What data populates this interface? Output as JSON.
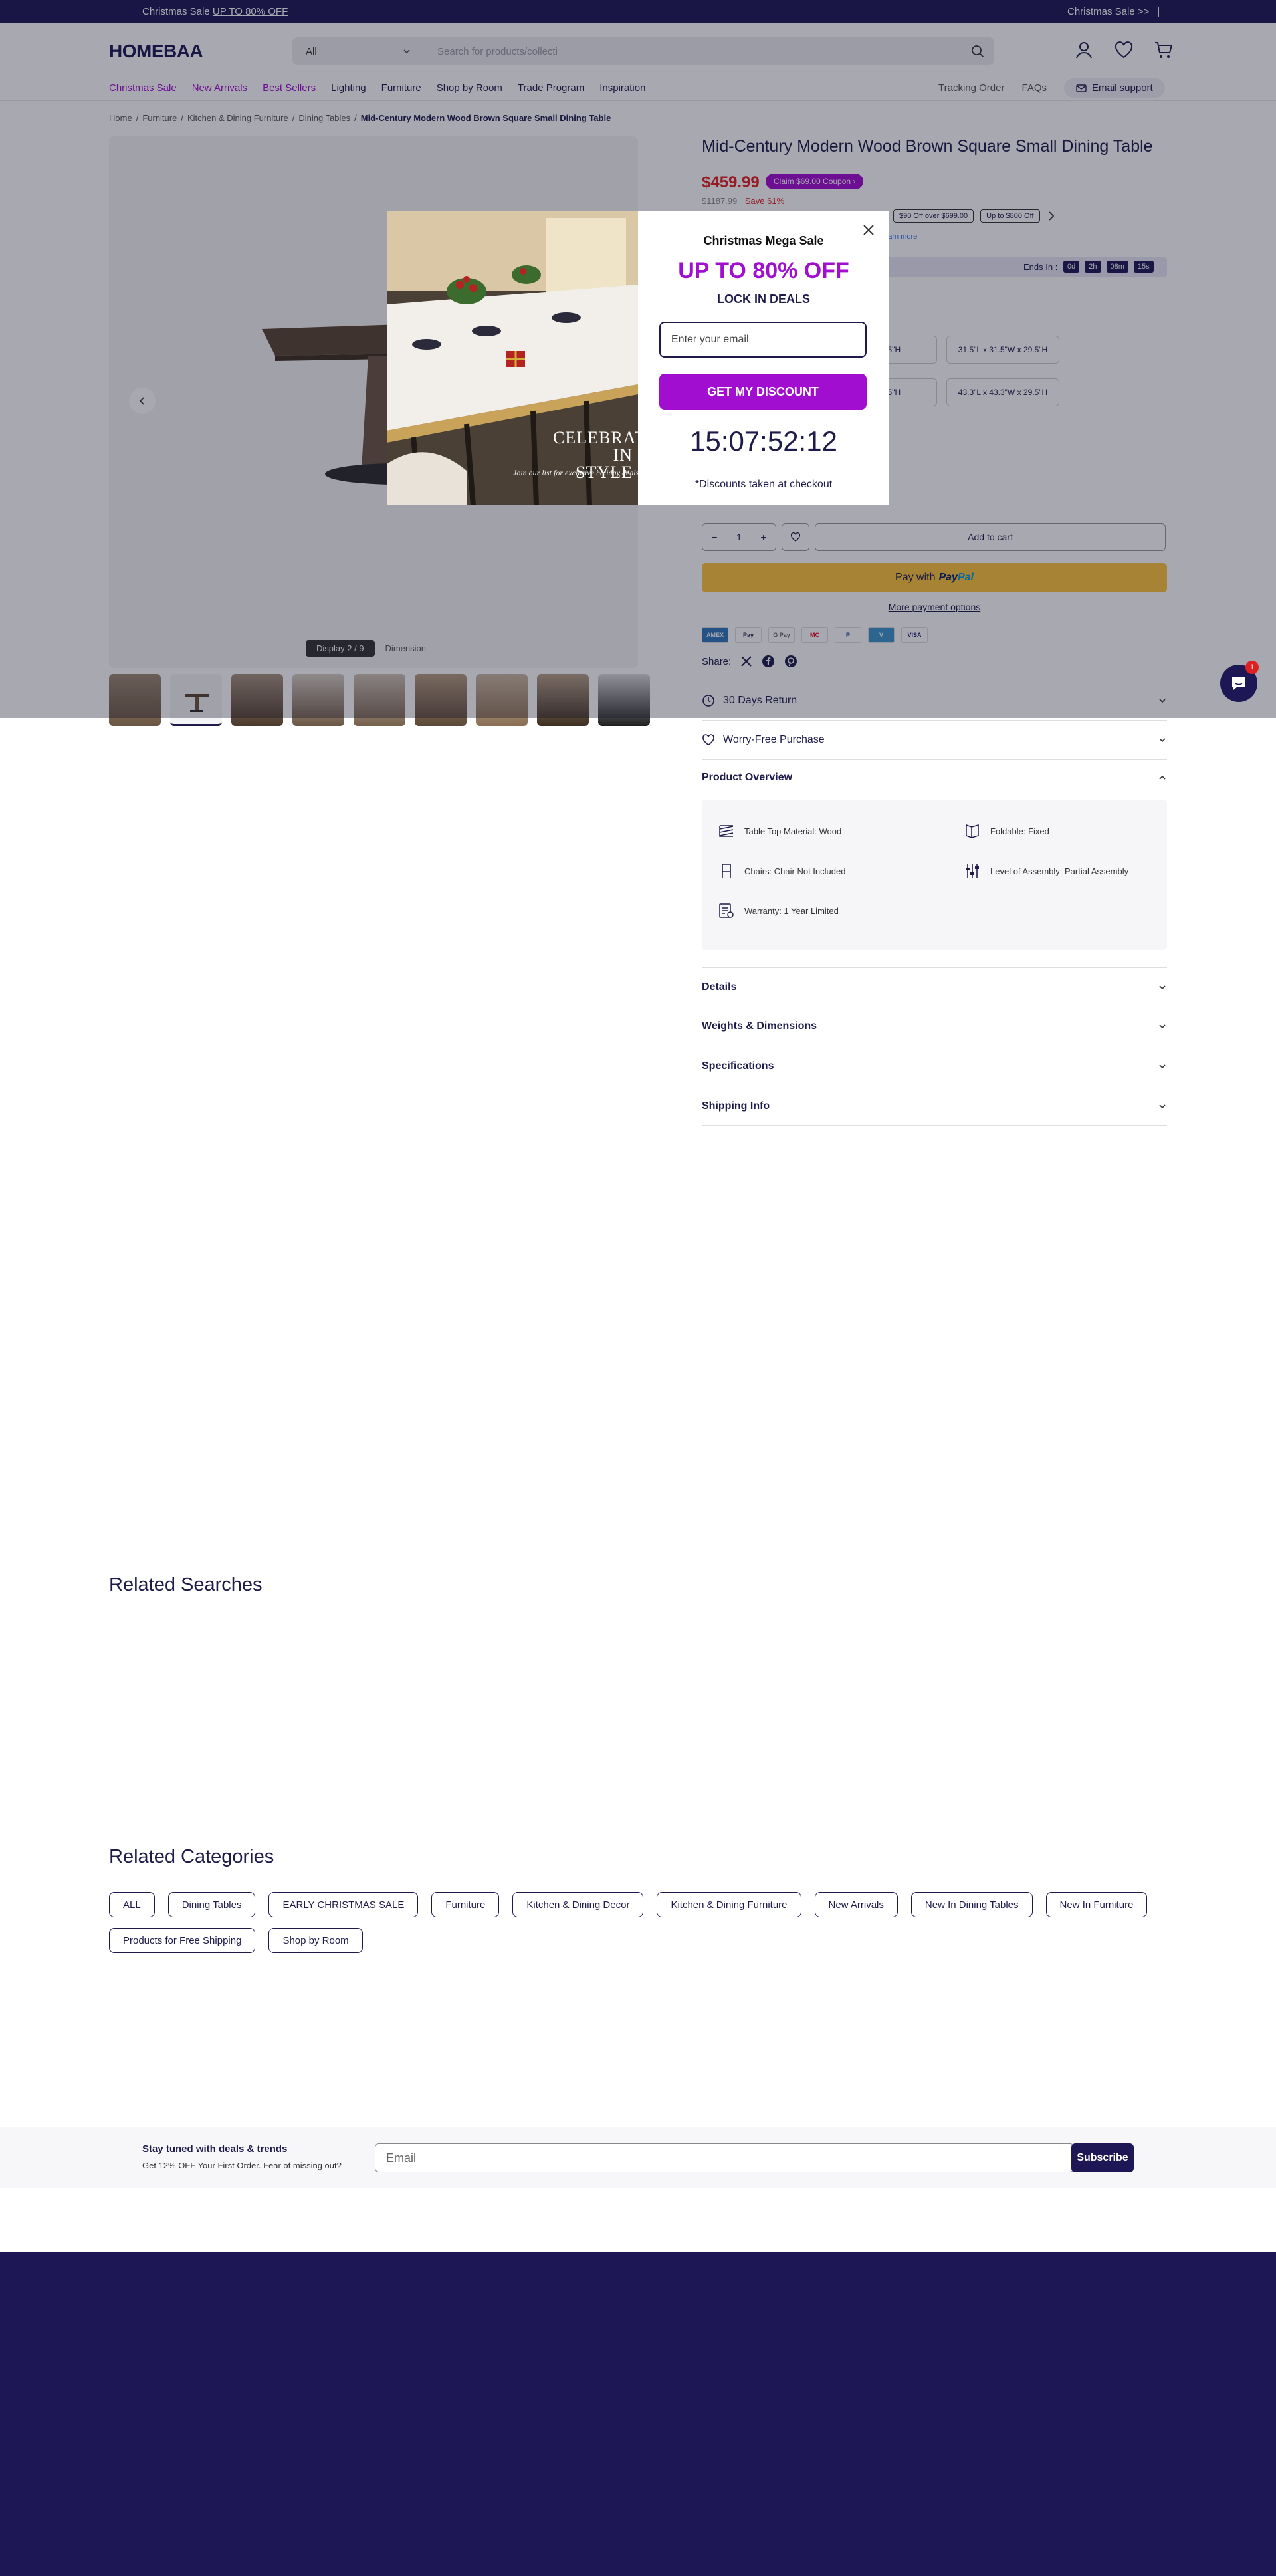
{
  "announcement": {
    "left_text": "Christmas Sale",
    "left_link": "UP TO 80% OFF",
    "right_text": "Christmas Sale >>",
    "divider": "|"
  },
  "header": {
    "logo": "HOMEBAA",
    "search_category": "All",
    "search_placeholder": "Search for products/collecti",
    "nav": [
      "Christmas Sale",
      "New Arrivals",
      "Best Sellers",
      "Lighting",
      "Furniture",
      "Shop by Room",
      "Trade Program",
      "Inspiration"
    ],
    "tracking": "Tracking Order",
    "faqs": "FAQs",
    "support": "Email support"
  },
  "breadcrumb": [
    "Home",
    "Furniture",
    "Kitchen & Dining Furniture",
    "Dining Tables",
    "Mid-Century Modern Wood Brown Square Small Dining Table"
  ],
  "gallery": {
    "display_label": "Display 2 / 9",
    "dimension_label": "Dimension"
  },
  "product": {
    "title": "Mid-Century Modern Wood Brown Square Small Dining Table",
    "price": "$459.99",
    "coupon": "Claim $69.00 Coupon",
    "old_price": "$1187.99",
    "save": "Save 61%",
    "promo_chips": [
      "$90 Off over $699.00",
      "Up to $800 Off"
    ],
    "paypal_learn": "Learn more",
    "ends_label": "Ends In :",
    "ends_boxes": [
      "0d",
      "2h",
      "08m",
      "15s"
    ],
    "sizes": [
      "W x 29.5\"H",
      "31.5\"L x 31.5\"W x 29.5\"H",
      "W x 29.5\"H",
      "43.3\"L x 43.3\"W x 29.5\"H"
    ],
    "qty": "1",
    "add_to_cart": "Add to cart",
    "pay_with": "Pay with",
    "more_payment": "More payment options",
    "pay_icons": [
      "AMEX",
      "Pay",
      "G Pay",
      "MC",
      "P",
      "V",
      "VISA"
    ],
    "share": "Share:"
  },
  "accordions": {
    "returns": "30 Days Return",
    "worry": "Worry-Free Purchase",
    "overview": "Product Overview",
    "details": "Details",
    "weights": "Weights & Dimensions",
    "specs": "Specifications",
    "shipping": "Shipping Info"
  },
  "overview_items": [
    "Table Top Material: Wood",
    "Foldable: Fixed",
    "Chairs: Chair Not Included",
    "Level of Assembly: Partial Assembly",
    "Warranty: 1 Year Limited"
  ],
  "related_searches_title": "Related Searches",
  "related_categories_title": "Related Categories",
  "related_categories": [
    "ALL",
    "Dining Tables",
    "EARLY CHRISTMAS SALE",
    "Furniture",
    "Kitchen & Dining Decor",
    "Kitchen & Dining Furniture",
    "New Arrivals",
    "New In Dining Tables",
    "New In Furniture",
    "Products for Free Shipping",
    "Shop by Room"
  ],
  "newsletter": {
    "title": "Stay tuned with deals & trends",
    "subtitle": "Get 12% OFF Your First Order. Fear of missing out?",
    "placeholder": "Email",
    "button": "Subscribe"
  },
  "chat": {
    "badge": "1"
  },
  "popup": {
    "image_title": "CELEBRATE IN STYLE",
    "image_sub": "Join our list for exclusive holiday deals",
    "heading": "Christmas Mega Sale",
    "offer": "UP TO 80% OFF",
    "lock": "LOCK IN DEALS",
    "email_placeholder": "Enter your email",
    "button": "GET MY DISCOUNT",
    "timer": "15:07:52:12",
    "note": "*Discounts taken at checkout"
  }
}
